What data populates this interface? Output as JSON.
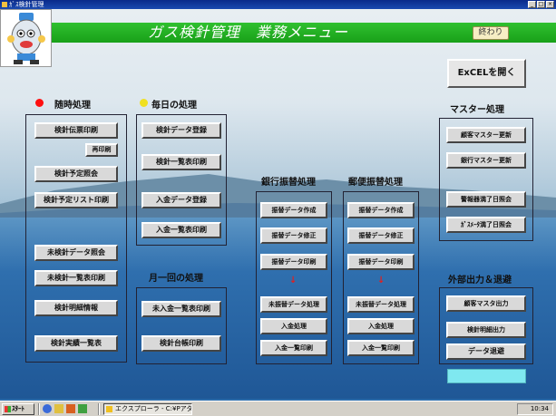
{
  "window": {
    "title": "ｶﾞｽ検針管理",
    "controls": [
      "_",
      "□",
      "×"
    ]
  },
  "banner": {
    "title": "ガス検針管理　業務メニュー",
    "exit_label": "終わり"
  },
  "excel_button": "ExCELを開く",
  "sections": {
    "adhoc": {
      "title": "随時処理",
      "dot_color": "#ff1010",
      "buttons": [
        "検針伝票印刷",
        "再印刷",
        "検針予定照会",
        "検針予定リスト印刷",
        "未検針データ照会",
        "未検針一覧表印刷",
        "検針明細情報",
        "検針実績一覧表"
      ]
    },
    "daily": {
      "title": "毎日の処理",
      "dot_color": "#f0e020",
      "buttons": [
        "検針データ登録",
        "検針一覧表印刷",
        "入金データ登録",
        "入金一覧表印刷"
      ]
    },
    "monthly": {
      "title": "月一回の処理",
      "buttons": [
        "未入金一覧表印刷",
        "検針台帳印刷"
      ]
    },
    "bank": {
      "title": "銀行振替処理",
      "buttons": [
        "振替データ作成",
        "振替データ修正",
        "振替データ印刷",
        "未振替データ処理",
        "入金処理",
        "入金一覧印刷"
      ]
    },
    "postal": {
      "title": "郵便振替処理",
      "buttons": [
        "振替データ作成",
        "振替データ修正",
        "振替データ印刷",
        "未振替データ処理",
        "入金処理",
        "入金一覧印刷"
      ]
    },
    "master": {
      "title": "マスター処理",
      "buttons": [
        "顧客マスター更新",
        "銀行マスター更新",
        "警報器満了日照会",
        "ｶﾞｽﾒｰﾀ満了日照会"
      ]
    },
    "external": {
      "title": "外部出力＆退避",
      "buttons": [
        "顧客マスタ出力",
        "検針明細出力",
        "データ退避"
      ]
    }
  },
  "arrow_glyph": "↓",
  "taskbar": {
    "start_label": "ｽﾀｰﾄ",
    "task_label": "エクスプローラ - C:¥Pアダス...",
    "clock": "10:34"
  }
}
